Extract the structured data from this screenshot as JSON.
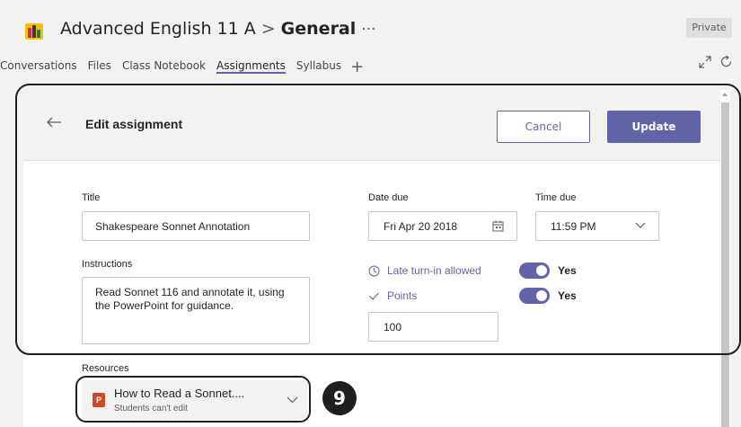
{
  "header": {
    "team_name": "Advanced English 11 A",
    "separator": ">",
    "channel": "General",
    "more": "···",
    "private_badge": "Private"
  },
  "tabs": [
    {
      "label": "Conversations",
      "active": false
    },
    {
      "label": "Files",
      "active": false
    },
    {
      "label": "Class Notebook",
      "active": false
    },
    {
      "label": "Assignments",
      "active": true
    },
    {
      "label": "Syllabus",
      "active": false
    }
  ],
  "tab_add": "+",
  "panel": {
    "title": "Edit assignment",
    "cancel_label": "Cancel",
    "update_label": "Update"
  },
  "form": {
    "title_label": "Title",
    "title_value": "Shakespeare Sonnet Annotation",
    "date_label": "Date due",
    "date_value": "Fri Apr 20 2018",
    "time_label": "Time due",
    "time_value": "11:59 PM",
    "instructions_label": "Instructions",
    "instructions_value": "Read Sonnet 116 and annotate it, using the PowerPoint for guidance.",
    "late_label": "Late turn-in allowed",
    "late_toggle": "Yes",
    "points_label": "Points",
    "points_toggle": "Yes",
    "points_value": "100"
  },
  "resources": {
    "label": "Resources",
    "items": [
      {
        "name": "How to Read a Sonnet....",
        "subtitle": "Students can't edit",
        "icon": "powerpoint-icon",
        "icon_letter": "P"
      }
    ]
  },
  "callout": {
    "step": "9"
  },
  "colors": {
    "accent": "#6264a7",
    "background": "#f3f2f1",
    "powerpoint": "#d24726"
  }
}
